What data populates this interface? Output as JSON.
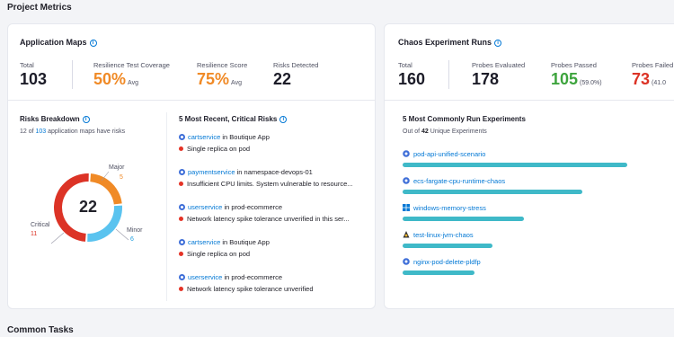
{
  "page": {
    "section_title": "Project Metrics",
    "footer_title": "Common Tasks"
  },
  "app_maps": {
    "title": "Application Maps",
    "total_label": "Total",
    "total_value": "103",
    "coverage_label": "Resilience Test Coverage",
    "coverage_value": "50%",
    "coverage_suffix": "Avg",
    "score_label": "Resilience Score",
    "score_value": "75%",
    "score_suffix": "Avg",
    "risks_label": "Risks Detected",
    "risks_value": "22"
  },
  "chaos": {
    "title": "Chaos Experiment Runs",
    "total_label": "Total",
    "total_value": "160",
    "probes_eval_label": "Probes Evaluated",
    "probes_eval_value": "178",
    "probes_passed_label": "Probes Passed",
    "probes_passed_value": "105",
    "probes_passed_pct": "(59.0%)",
    "probes_failed_label": "Probes Failed",
    "probes_failed_value": "73",
    "probes_failed_pct": "(41.0"
  },
  "risks_breakdown": {
    "title": "Risks Breakdown",
    "subtitle_prefix": "12 of ",
    "subtitle_count": "103",
    "subtitle_suffix": " application maps have risks",
    "center_value": "22",
    "segments": [
      {
        "label": "Major",
        "value": 5,
        "color": "#f08a26"
      },
      {
        "label": "Minor",
        "value": 6,
        "color": "#5ac3ef"
      },
      {
        "label": "Critical",
        "value": 11,
        "color": "#dc3326"
      }
    ],
    "major_label": "Major",
    "major_value": "5",
    "minor_label": "Minor",
    "minor_value": "6",
    "critical_label": "Critical",
    "critical_value": "11"
  },
  "recent_risks": {
    "title": "5 Most Recent, Critical Risks",
    "items": [
      {
        "service": "cartservice",
        "context": " in Boutique App",
        "risk": "Single replica on pod"
      },
      {
        "service": "paymentservice",
        "context": " in namespace-devops-01",
        "risk": "Insufficient CPU limits. System vulnerable to resource..."
      },
      {
        "service": "userservice",
        "context": " in prod-ecommerce",
        "risk": "Network latency spike tolerance unverified in this ser..."
      },
      {
        "service": "cartservice",
        "context": " in Boutique App",
        "risk": "Single replica on pod"
      },
      {
        "service": "userservice",
        "context": " in prod-ecommerce",
        "risk": "Network latency spike tolerance unverified"
      }
    ]
  },
  "experiments": {
    "title": "5 Most Commonly Run Experiments",
    "subtitle_prefix": "Out of ",
    "subtitle_count": "42",
    "subtitle_suffix": " Unique Experiments",
    "items": [
      {
        "name": "pod-api-unified-scenario",
        "icon": "kubernetes-icon",
        "runs": 100
      },
      {
        "name": "ecs-fargate-cpu-runtime-chaos",
        "icon": "kubernetes-icon",
        "runs": 80
      },
      {
        "name": "windows-memory-stress",
        "icon": "windows-icon",
        "runs": 54
      },
      {
        "name": "test-linux-jvm-chaos",
        "icon": "linux-icon",
        "runs": 40
      },
      {
        "name": "nginx-pod-delete-pldfp",
        "icon": "kubernetes-icon",
        "runs": 32
      }
    ]
  }
}
